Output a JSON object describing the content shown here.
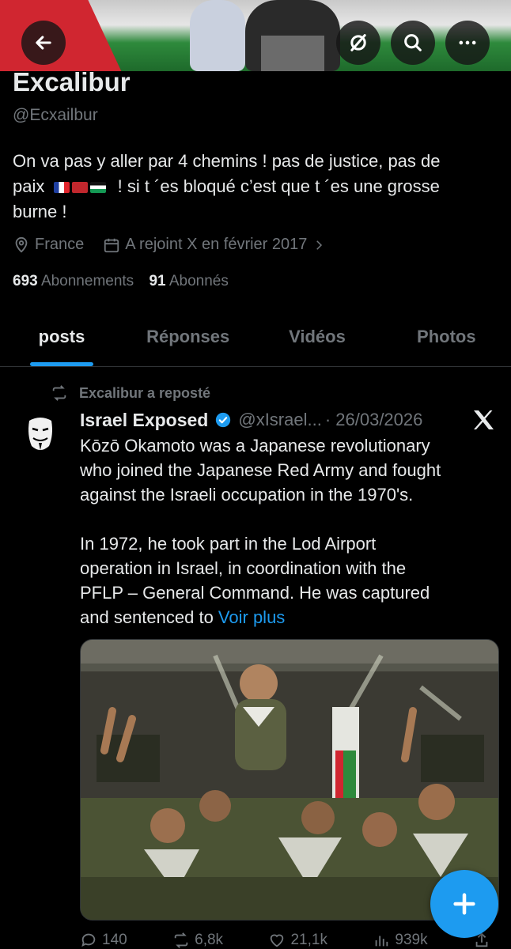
{
  "header": {
    "back_icon": "arrow-left-icon",
    "actions": [
      "grok-icon",
      "search-icon",
      "more-icon"
    ]
  },
  "profile": {
    "name": "Excalibur",
    "handle": "@Ecxailbur",
    "bio_line1": "On va pas y aller par 4 chemins ! pas de justice, pas de",
    "bio_line2_prefix": "paix",
    "bio_line2_suffix": "! si t ´es bloqué c’est que t ´es une grosse",
    "bio_line3": "burne !",
    "location": "France",
    "joined": "A rejoint X en février 2017",
    "following_count": "693",
    "following_label": "Abonnements",
    "followers_count": "91",
    "followers_label": "Abonnés"
  },
  "tabs": [
    {
      "label": "posts",
      "active": true
    },
    {
      "label": "Réponses",
      "active": false
    },
    {
      "label": "Vidéos",
      "active": false
    },
    {
      "label": "Photos",
      "active": false
    }
  ],
  "feed": {
    "repost_label": "Excalibur a reposté",
    "post": {
      "author_name": "Israel Exposed",
      "author_handle": "@xIsrael...",
      "date": "· 26/03/2026",
      "text": "Kōzō Okamoto was a Japanese revolutionary\nwho joined the Japanese Red Army and fought\nagainst the Israeli occupation in the 1970's.\n\nIn 1972, he took part in the Lod Airport\noperation in Israel, in coordination with the\nPFLP – General Command. He was captured\nand sentenced to ",
      "more_label": "Voir plus",
      "replies": "140",
      "reposts": "6,8k",
      "likes": "21,1k",
      "views": "939k"
    }
  },
  "colors": {
    "accent": "#1d9bf0",
    "muted": "#71767b",
    "text": "#e7e9ea",
    "background": "#000000"
  }
}
